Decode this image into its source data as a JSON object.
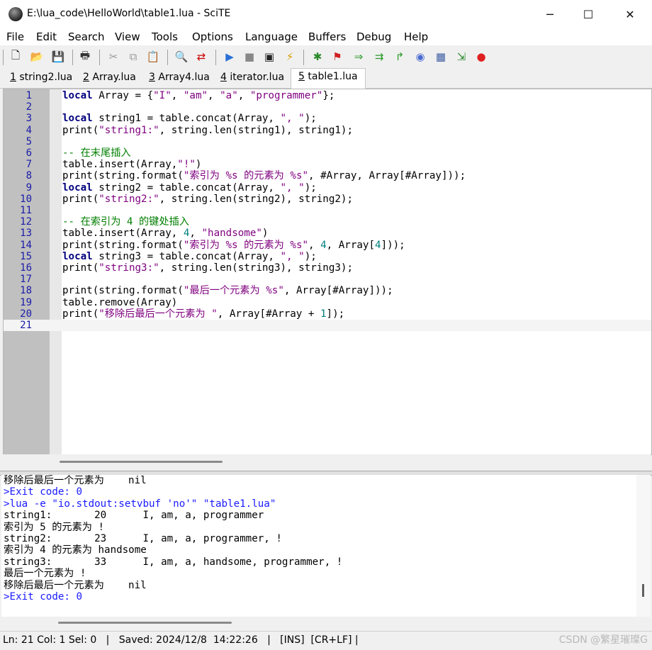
{
  "window": {
    "title": "E:\\lua_code\\HelloWorld\\table1.lua - SciTE",
    "minimize": "─",
    "maximize": "☐",
    "close": "✕"
  },
  "menu": [
    "File",
    "Edit",
    "Search",
    "View",
    "Tools",
    "Options",
    "Language",
    "Buffers",
    "Debug",
    "Help"
  ],
  "tabs": [
    {
      "num": "1",
      "label": "string2.lua",
      "active": false
    },
    {
      "num": "2",
      "label": "Array.lua",
      "active": false
    },
    {
      "num": "3",
      "label": "Array4.lua",
      "active": false
    },
    {
      "num": "4",
      "label": "iterator.lua",
      "active": false
    },
    {
      "num": "5",
      "label": "table1.lua",
      "active": true
    }
  ],
  "editor": {
    "lines": [
      {
        "n": "1",
        "tokens": [
          [
            "kw",
            "local"
          ],
          [
            "op",
            " Array = {"
          ],
          [
            "str",
            "\"I\""
          ],
          [
            "op",
            ", "
          ],
          [
            "str",
            "\"am\""
          ],
          [
            "op",
            ", "
          ],
          [
            "str",
            "\"a\""
          ],
          [
            "op",
            ", "
          ],
          [
            "str",
            "\"programmer\""
          ],
          [
            "op",
            "};"
          ]
        ]
      },
      {
        "n": "2",
        "tokens": []
      },
      {
        "n": "3",
        "tokens": [
          [
            "kw",
            "local"
          ],
          [
            "op",
            " string1 = table.concat(Array, "
          ],
          [
            "str",
            "\", \""
          ],
          [
            "op",
            ");"
          ]
        ]
      },
      {
        "n": "4",
        "tokens": [
          [
            "op",
            "print("
          ],
          [
            "str",
            "\"string1:\""
          ],
          [
            "op",
            ", string.len(string1), string1);"
          ]
        ]
      },
      {
        "n": "5",
        "tokens": []
      },
      {
        "n": "6",
        "tokens": [
          [
            "cmt",
            "-- 在末尾插入"
          ]
        ]
      },
      {
        "n": "7",
        "tokens": [
          [
            "op",
            "table.insert(Array,"
          ],
          [
            "str",
            "\"!\""
          ],
          [
            "op",
            ")"
          ]
        ]
      },
      {
        "n": "8",
        "tokens": [
          [
            "op",
            "print(string.format("
          ],
          [
            "str",
            "\"索引为 %s 的元素为 %s\""
          ],
          [
            "op",
            ", #Array, Array[#Array]));"
          ]
        ]
      },
      {
        "n": "9",
        "tokens": [
          [
            "kw",
            "local"
          ],
          [
            "op",
            " string2 = table.concat(Array, "
          ],
          [
            "str",
            "\", \""
          ],
          [
            "op",
            ");"
          ]
        ]
      },
      {
        "n": "10",
        "tokens": [
          [
            "op",
            "print("
          ],
          [
            "str",
            "\"string2:\""
          ],
          [
            "op",
            ", string.len(string2), string2);"
          ]
        ]
      },
      {
        "n": "11",
        "tokens": []
      },
      {
        "n": "12",
        "tokens": [
          [
            "cmt",
            "-- 在索引为 4 的键处插入"
          ]
        ]
      },
      {
        "n": "13",
        "tokens": [
          [
            "op",
            "table.insert(Array, "
          ],
          [
            "num-lit",
            "4"
          ],
          [
            "op",
            ", "
          ],
          [
            "str",
            "\"handsome\""
          ],
          [
            "op",
            ")"
          ]
        ]
      },
      {
        "n": "14",
        "tokens": [
          [
            "op",
            "print(string.format("
          ],
          [
            "str",
            "\"索引为 %s 的元素为 %s\""
          ],
          [
            "op",
            ", "
          ],
          [
            "num-lit",
            "4"
          ],
          [
            "op",
            ", Array["
          ],
          [
            "num-lit",
            "4"
          ],
          [
            "op",
            "]));"
          ]
        ]
      },
      {
        "n": "15",
        "tokens": [
          [
            "kw",
            "local"
          ],
          [
            "op",
            " string3 = table.concat(Array, "
          ],
          [
            "str",
            "\", \""
          ],
          [
            "op",
            ");"
          ]
        ]
      },
      {
        "n": "16",
        "tokens": [
          [
            "op",
            "print("
          ],
          [
            "str",
            "\"string3:\""
          ],
          [
            "op",
            ", string.len(string3), string3);"
          ]
        ]
      },
      {
        "n": "17",
        "tokens": []
      },
      {
        "n": "18",
        "tokens": [
          [
            "op",
            "print(string.format("
          ],
          [
            "str",
            "\"最后一个元素为 %s\""
          ],
          [
            "op",
            ", Array[#Array]));"
          ]
        ]
      },
      {
        "n": "19",
        "tokens": [
          [
            "op",
            "table.remove(Array)"
          ]
        ]
      },
      {
        "n": "20",
        "tokens": [
          [
            "op",
            "print("
          ],
          [
            "str",
            "\"移除后最后一个元素为 \""
          ],
          [
            "op",
            ", Array[#Array + "
          ],
          [
            "num-lit",
            "1"
          ],
          [
            "op",
            "]);"
          ]
        ]
      },
      {
        "n": "21",
        "tokens": []
      }
    ]
  },
  "output": [
    {
      "text": "移除后最后一个元素为    nil",
      "cmd": false
    },
    {
      "text": ">Exit code: 0",
      "cmd": true
    },
    {
      "text": ">lua -e \"io.stdout:setvbuf 'no'\" \"table1.lua\"",
      "cmd": true
    },
    {
      "text": "string1:       20      I, am, a, programmer",
      "cmd": false
    },
    {
      "text": "索引为 5 的元素为 !",
      "cmd": false
    },
    {
      "text": "string2:       23      I, am, a, programmer, !",
      "cmd": false
    },
    {
      "text": "索引为 4 的元素为 handsome",
      "cmd": false
    },
    {
      "text": "string3:       33      I, am, a, handsome, programmer, !",
      "cmd": false
    },
    {
      "text": "最后一个元素为 !",
      "cmd": false
    },
    {
      "text": "移除后最后一个元素为    nil",
      "cmd": false
    },
    {
      "text": ">Exit code: 0",
      "cmd": true
    }
  ],
  "status": {
    "text": "Ln: 21 Col: 1 Sel: 0   |   Saved: 2024/12/8  14:22:26   |   [INS]  [CR+LF] |"
  },
  "watermark": "CSDN @繁星璀璨G",
  "toolbar_icons": [
    {
      "name": "new-file-icon",
      "glyph": "🗋"
    },
    {
      "name": "open-folder-icon",
      "glyph": "📂"
    },
    {
      "name": "save-icon",
      "glyph": "💾"
    },
    {
      "name": "print-icon",
      "glyph": "🖶"
    },
    {
      "name": "cut-icon",
      "glyph": "✂"
    },
    {
      "name": "copy-icon",
      "glyph": "⧉"
    },
    {
      "name": "paste-icon",
      "glyph": "📋"
    },
    {
      "name": "find-icon",
      "glyph": "🔍"
    },
    {
      "name": "replace-icon",
      "glyph": "⇄"
    },
    {
      "name": "run-icon",
      "glyph": "▶"
    },
    {
      "name": "stop-icon",
      "glyph": "■"
    },
    {
      "name": "console-icon",
      "glyph": "▣"
    },
    {
      "name": "build-icon",
      "glyph": "⚡"
    },
    {
      "name": "debug-bug-icon",
      "glyph": "✱"
    },
    {
      "name": "breakpoint-flag-icon",
      "glyph": "⚑"
    },
    {
      "name": "step-over-icon",
      "glyph": "⇒"
    },
    {
      "name": "step-into-icon",
      "glyph": "⇉"
    },
    {
      "name": "step-out-icon",
      "glyph": "↱"
    },
    {
      "name": "watch-icon",
      "glyph": "◉"
    },
    {
      "name": "calculator-icon",
      "glyph": "▦"
    },
    {
      "name": "export-icon",
      "glyph": "⇲"
    },
    {
      "name": "record-icon",
      "glyph": "●"
    }
  ]
}
